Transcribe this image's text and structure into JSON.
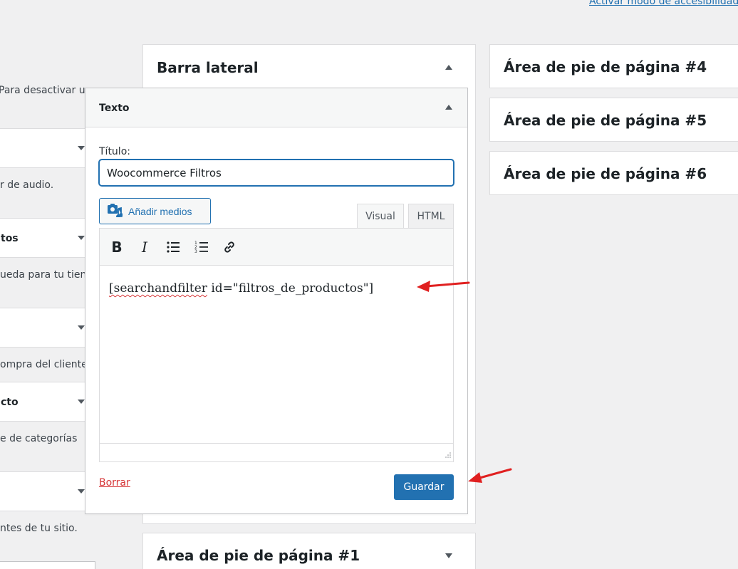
{
  "top": {
    "accessibility_link": "Activar modo de accesibilidad"
  },
  "left_panel": {
    "intro_text": "Para desactivar un",
    "widgets": [
      {
        "title": "",
        "desc": "r de audio."
      },
      {
        "title": "tos",
        "desc": "ueda para tu tien-"
      },
      {
        "title": "",
        "desc": "ompra del cliente."
      },
      {
        "title": "cto",
        "desc": "e de categorías"
      },
      {
        "title": "",
        "desc": "ntes de tu sitio."
      }
    ]
  },
  "sidebar": {
    "title": "Barra lateral"
  },
  "text_widget": {
    "header_title": "Texto",
    "title_label": "Título:",
    "title_value": "Woocommerce Filtros",
    "add_media_label": "Añadir medios",
    "tab_visual": "Visual",
    "tab_html": "HTML",
    "content_part1": "[searchandfilter",
    "content_part2": " id=\"filtros_de_productos\"]",
    "delete_label": "Borrar",
    "save_label": "Guardar"
  },
  "footer_areas": [
    {
      "title": "Área de pie de página #4"
    },
    {
      "title": "Área de pie de página #5"
    },
    {
      "title": "Área de pie de página #6"
    }
  ],
  "footer_area_1": {
    "title": "Área de pie de página #1"
  },
  "colors": {
    "accent": "#2271b1",
    "danger": "#d63638",
    "annotation": "#e02020"
  },
  "icons": [
    "media-icon",
    "bold-icon",
    "italic-icon",
    "bullet-list-icon",
    "numbered-list-icon",
    "link-icon",
    "collapse-arrow-icon",
    "expand-arrow-icon"
  ]
}
